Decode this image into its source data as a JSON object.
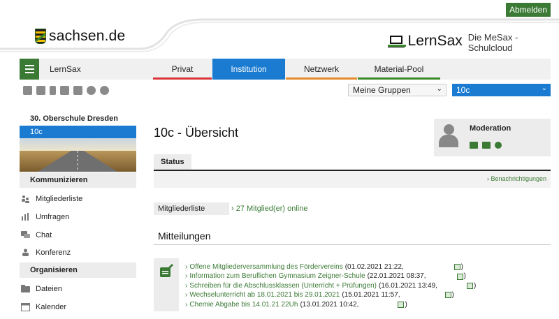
{
  "header": {
    "login_label": "Abmelden",
    "sachsen_brand": "sachsen.de",
    "lernsax_brand": "LernSax",
    "lernsax_subtitle": "Die MeSax - Schulcloud"
  },
  "nav": {
    "home_label": "LernSax",
    "tabs": [
      {
        "label": "Privat",
        "accent": "#d9343a"
      },
      {
        "label": "Institution",
        "accent": "#1a7bd1"
      },
      {
        "label": "Netzwerk",
        "accent": "#e58a2a"
      },
      {
        "label": "Material-Pool",
        "accent": "#3b8a2a"
      }
    ]
  },
  "selectors": {
    "groups": "Meine Gruppen",
    "class": "10c"
  },
  "sidebar": {
    "school": "30. Oberschule Dresden",
    "active": "10c",
    "sections": [
      {
        "heading": "Kommunizieren",
        "items": [
          "Mitgliederliste",
          "Umfragen",
          "Chat",
          "Konferenz"
        ]
      },
      {
        "heading": "Organisieren",
        "items": [
          "Dateien",
          "Kalender"
        ]
      }
    ]
  },
  "main": {
    "title": "10c - Übersicht",
    "status_tab": "Status",
    "notifications_link": "Benachrichtigungen",
    "moderation_label": "Moderation",
    "members_label": "Mitgliederliste",
    "members_link": "27 Mitglied(er) online",
    "messages_title": "Mitteilungen",
    "messages": [
      {
        "title": "Offene Mitgliederversammlung des Fördervereins",
        "date": "(01.02.2021 21:22,"
      },
      {
        "title": "Information zum Beruflichen Gymnasium Zeigner-Schule",
        "date": "(22.01.2021 08:37,"
      },
      {
        "title": "Schreiben für die Abschlussklassen (Unterricht + Prüfungen)",
        "date": "(16.01.2021 13:49,"
      },
      {
        "title": "Wechselunterricht ab 18.01.2021 bis 29.01.2021",
        "date": "(15.01.2021 11:57,"
      },
      {
        "title": "Chemie Abgabe bis 14.01.21 22Uh",
        "date": "(13.01.2021 10:42,"
      }
    ]
  },
  "colors": {
    "green": "#3b7a35",
    "blue": "#1a7bd1"
  }
}
